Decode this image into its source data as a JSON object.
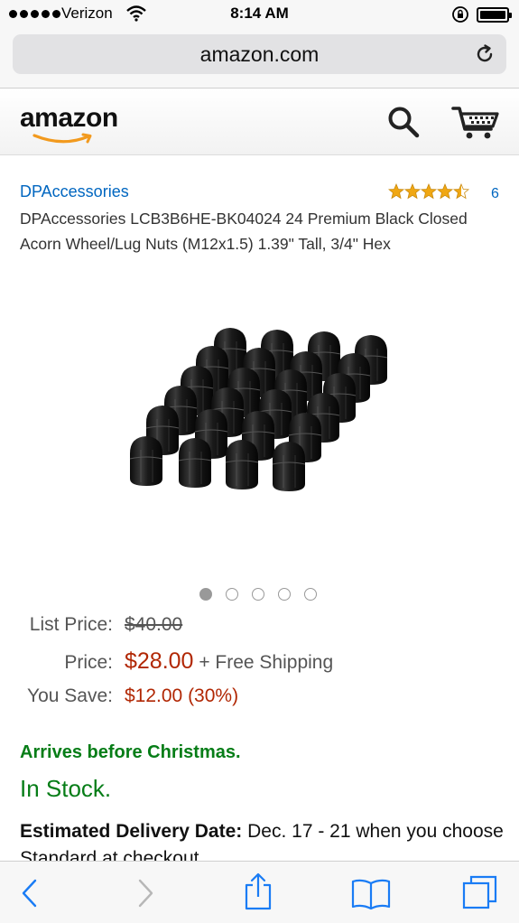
{
  "status_bar": {
    "carrier": "Verizon",
    "time": "8:14 AM"
  },
  "browser": {
    "url": "amazon.com"
  },
  "header": {
    "logo": "amazon"
  },
  "product": {
    "brand": "DPAccessories",
    "rating_stars": 4.5,
    "rating_count": "6",
    "title": "DPAccessories LCB3B6HE-BK04024 24 Premium Black Closed Acorn Wheel/Lug Nuts (M12x1.5) 1.39\" Tall, 3/4\" Hex",
    "image_count": 5,
    "image_index": 1
  },
  "pricing": {
    "list_price_label": "List Price:",
    "list_price": "$40.00",
    "price_label": "Price:",
    "price": "$28.00",
    "shipping": "+ Free Shipping",
    "you_save_label": "You Save:",
    "you_save": "$12.00 (30%)"
  },
  "availability": {
    "arrives": "Arrives before Christmas.",
    "stock": "In Stock.",
    "delivery_label": "Estimated Delivery Date:",
    "delivery_text": "Dec. 17 - 21 when you choose Standard at checkout"
  },
  "colors": {
    "link_blue": "#0066c0",
    "price_red": "#b12704",
    "stock_green": "#067d17",
    "star_orange": "#f0a713",
    "ios_blue": "#1a7cf5"
  }
}
